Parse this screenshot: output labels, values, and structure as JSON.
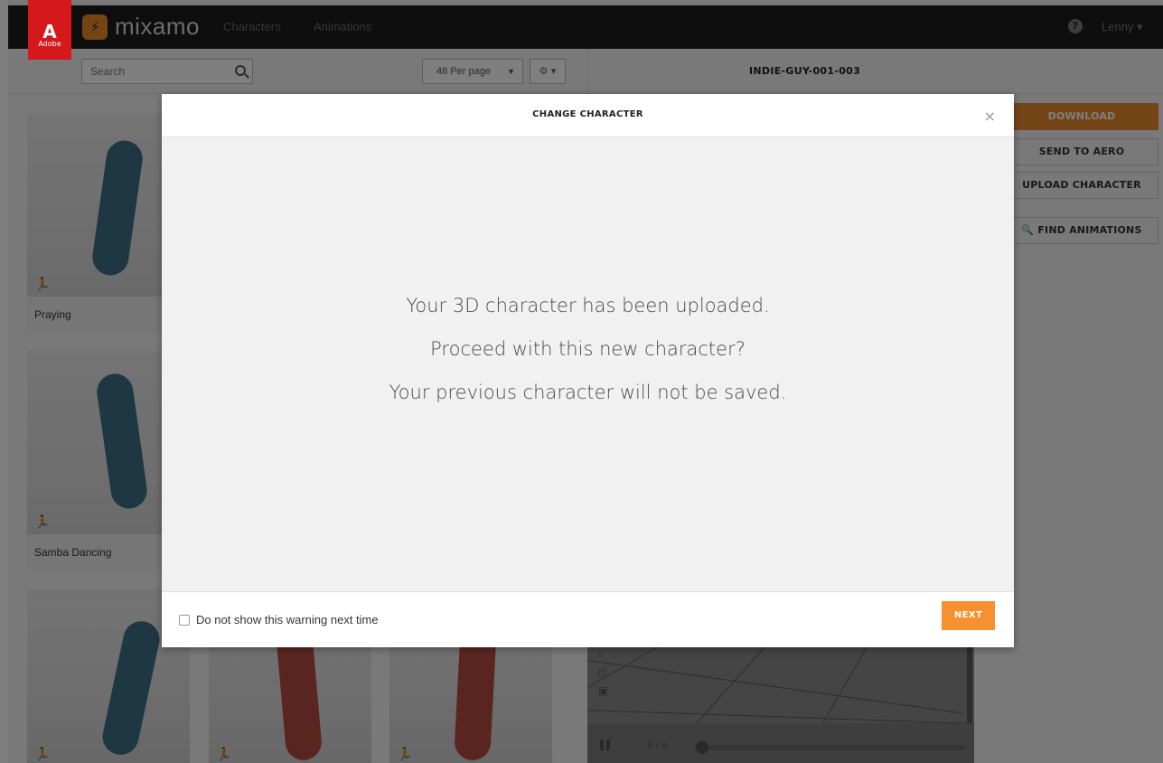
{
  "adobe": {
    "glyph": "A",
    "label": "Adobe"
  },
  "brand": {
    "name": "mixamo",
    "logo_icon": "mixamo-runner-icon"
  },
  "nav": {
    "characters": "Characters",
    "animations": "Animations"
  },
  "header": {
    "help_glyph": "?",
    "user": "Lenny ▾"
  },
  "toolbar": {
    "search_placeholder": "Search",
    "per_page": "48 Per page",
    "per_page_caret": "▼",
    "gear": "⚙ ▾",
    "character_name": "INDIE-GUY-001-003"
  },
  "cards": [
    {
      "label": "Praying"
    },
    {
      "label": "Samba Dancing"
    },
    {
      "label": ""
    },
    {
      "label": ""
    },
    {
      "label": ""
    }
  ],
  "right_panel": {
    "download": "DOWNLOAD",
    "send_to_aero": "SEND TO AERO",
    "upload_character": "UPLOAD CHARACTER",
    "find_animations": "🔍 FIND ANIMATIONS"
  },
  "player": {
    "frame_count": "0 / 0"
  },
  "modal": {
    "title": "CHANGE CHARACTER",
    "close": "×",
    "line1": "Your 3D character has been uploaded.",
    "line2": "Proceed with this new character?",
    "line3": "Your previous character will not be saved.",
    "checkbox_label": "Do not show this warning next time",
    "checkbox_checked": false,
    "next": "NEXT"
  },
  "colors": {
    "accent_orange": "#f7902e",
    "adobe_red": "#d4181c",
    "topbar": "#1d1d1d"
  }
}
